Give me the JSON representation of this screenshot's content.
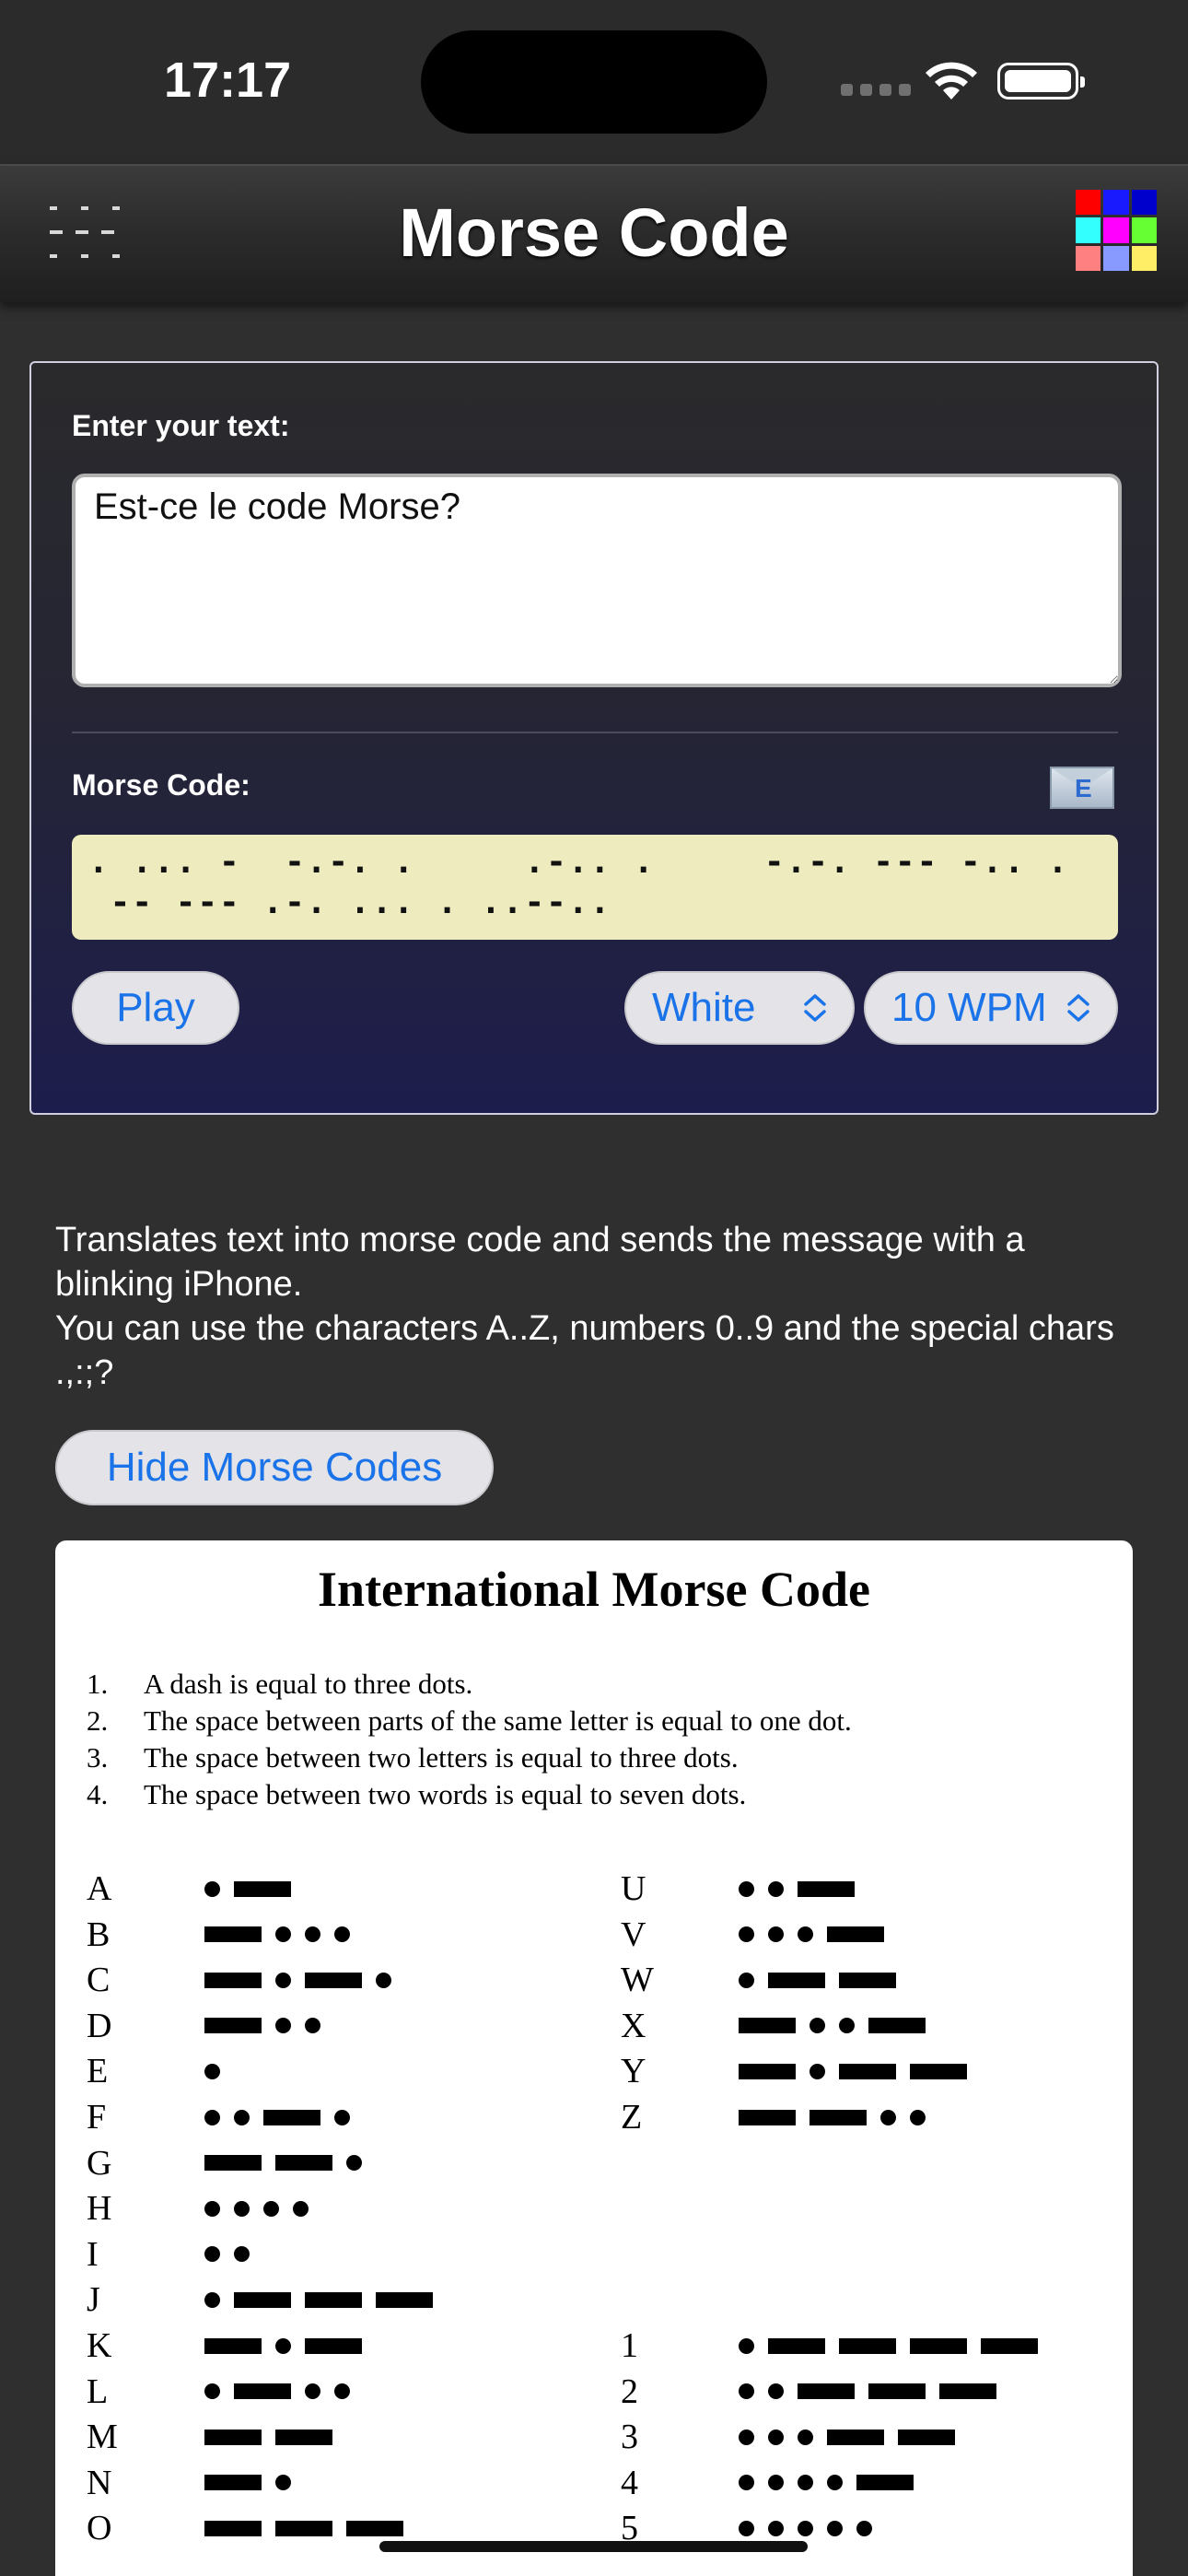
{
  "status": {
    "time": "17:17"
  },
  "nav": {
    "title": "Morse Code",
    "grid_colors": [
      "#ff0000",
      "#1a1aff",
      "#0000cc",
      "#33ffff",
      "#ff00ff",
      "#66ff33",
      "#ff8080",
      "#8899ff",
      "#ffee66"
    ]
  },
  "input": {
    "label": "Enter your text:",
    "value": "Est-ce le code Morse?"
  },
  "output": {
    "label": "Morse Code:",
    "morse": ". ... -  -.-. .     .-.. .     -.-. --- -.. .\n -- --- .-. ... . ..--..",
    "mail_letter": "E"
  },
  "controls": {
    "play_label": "Play",
    "color_value": "White",
    "speed_value": "10 WPM"
  },
  "description": {
    "line1": "Translates text into morse code and sends the message with a blinking iPhone.",
    "line2": "You can use the characters A..Z, numbers 0..9 and the special chars .,:;?"
  },
  "toggle_button": "Hide Morse Codes",
  "reference": {
    "title": "International Morse Code",
    "rules": [
      {
        "num": "1.",
        "text": "A dash is equal to three dots."
      },
      {
        "num": "2.",
        "text": "The space between parts of the same letter is equal to one dot."
      },
      {
        "num": "3.",
        "text": "The space between two letters is equal to three dots."
      },
      {
        "num": "4.",
        "text": "The space between two words is equal to seven dots."
      }
    ],
    "codes": [
      {
        "ch": "A",
        "code": ".-"
      },
      {
        "ch": "B",
        "code": "-..."
      },
      {
        "ch": "C",
        "code": "-.-."
      },
      {
        "ch": "D",
        "code": "-.."
      },
      {
        "ch": "E",
        "code": "."
      },
      {
        "ch": "F",
        "code": "..-."
      },
      {
        "ch": "G",
        "code": "--."
      },
      {
        "ch": "H",
        "code": "...."
      },
      {
        "ch": "I",
        "code": ".."
      },
      {
        "ch": "J",
        "code": ".---"
      },
      {
        "ch": "K",
        "code": "-.-"
      },
      {
        "ch": "L",
        "code": ".-.."
      },
      {
        "ch": "M",
        "code": "--"
      },
      {
        "ch": "N",
        "code": "-."
      },
      {
        "ch": "O",
        "code": "---"
      },
      {
        "ch": "U",
        "code": "..-"
      },
      {
        "ch": "V",
        "code": "...-"
      },
      {
        "ch": "W",
        "code": ".--"
      },
      {
        "ch": "X",
        "code": "-..-"
      },
      {
        "ch": "Y",
        "code": "-.--"
      },
      {
        "ch": "Z",
        "code": "--.."
      },
      {
        "ch": "1",
        "code": ".----"
      },
      {
        "ch": "2",
        "code": "..---"
      },
      {
        "ch": "3",
        "code": "...--"
      },
      {
        "ch": "4",
        "code": "....-"
      },
      {
        "ch": "5",
        "code": "....."
      }
    ]
  }
}
